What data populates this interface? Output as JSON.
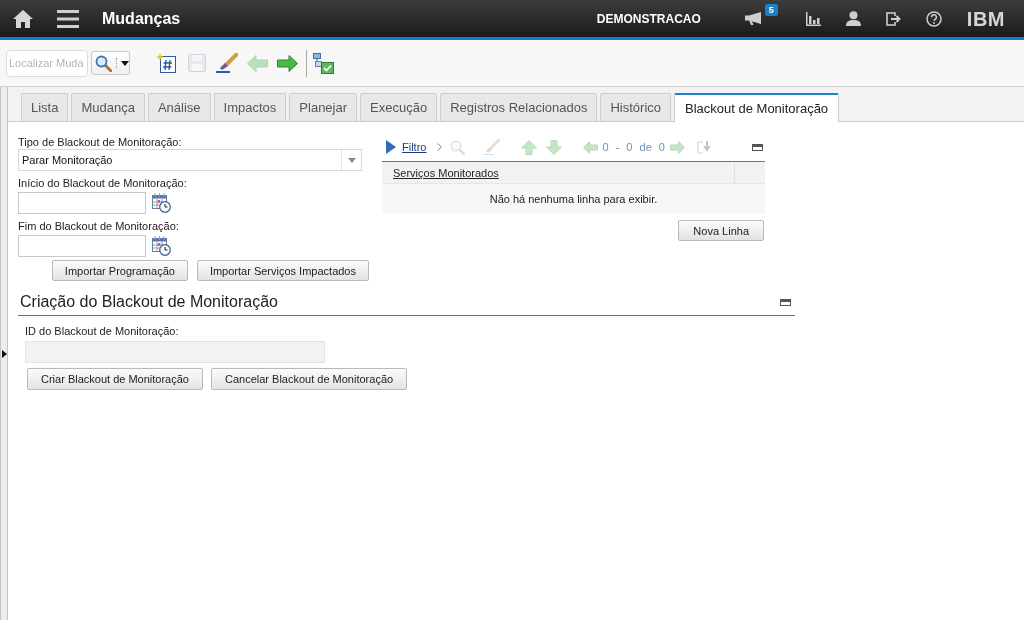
{
  "header": {
    "title": "Mudanças",
    "user": "DEMONSTRACAO",
    "notifications": "5",
    "logo": "IBM"
  },
  "toolbar": {
    "search": {
      "placeholder": "Localizar Muda"
    },
    "tools": [
      {
        "kind": "new",
        "disabled": false
      },
      {
        "kind": "save",
        "disabled": true
      },
      {
        "kind": "clear",
        "disabled": false
      },
      {
        "kind": "back",
        "disabled": true
      },
      {
        "kind": "forward",
        "disabled": false
      },
      {
        "kind": "separator"
      },
      {
        "kind": "workflow",
        "disabled": false
      }
    ]
  },
  "tabs": [
    {
      "label": "Lista",
      "selected": false
    },
    {
      "label": "Mudança",
      "selected": false
    },
    {
      "label": "Análise",
      "selected": false
    },
    {
      "label": "Impactos",
      "selected": false
    },
    {
      "label": "Planejar",
      "selected": false
    },
    {
      "label": "Execução",
      "selected": false
    },
    {
      "label": "Registros Relacionados",
      "selected": false
    },
    {
      "label": "Histórico",
      "selected": false
    },
    {
      "label": "Blackout de Monitoração",
      "selected": true
    }
  ],
  "blackout_form": {
    "type": {
      "label": "Tipo de Blackout de Monitoração:",
      "value": "Parar Monitoração"
    },
    "start": {
      "label": "Início do Blackout de Monitoração:"
    },
    "end": {
      "label": "Fim do Blackout de Monitoração:"
    },
    "buttons": [
      "Importar Programação",
      "Importar Serviços Impactados"
    ]
  },
  "services_table": {
    "filter": "Filtro",
    "tools": [
      {
        "kind": "search",
        "disabled": true
      },
      {
        "kind": "clear",
        "disabled": true
      },
      {
        "kind": "up",
        "disabled": true
      },
      {
        "kind": "down",
        "disabled": true
      },
      {
        "kind": "previous",
        "disabled": true
      },
      {
        "kind": "range",
        "text": "0 - 0 de 0"
      },
      {
        "kind": "next",
        "disabled": true
      },
      {
        "kind": "download",
        "disabled": true
      }
    ],
    "columns": [
      "Serviços Monitorados"
    ],
    "empty_message": "Não há nenhuma linha para exibir.",
    "add_button": "Nova Linha"
  },
  "creation_section": {
    "title": "Criação do Blackout de Monitoração",
    "id_field": {
      "label": "ID do Blackout de Monitoração:",
      "readonly": true
    },
    "buttons": [
      "Criar Blackout de Monitoração",
      "Cancelar Blackout de Monitoração"
    ]
  }
}
